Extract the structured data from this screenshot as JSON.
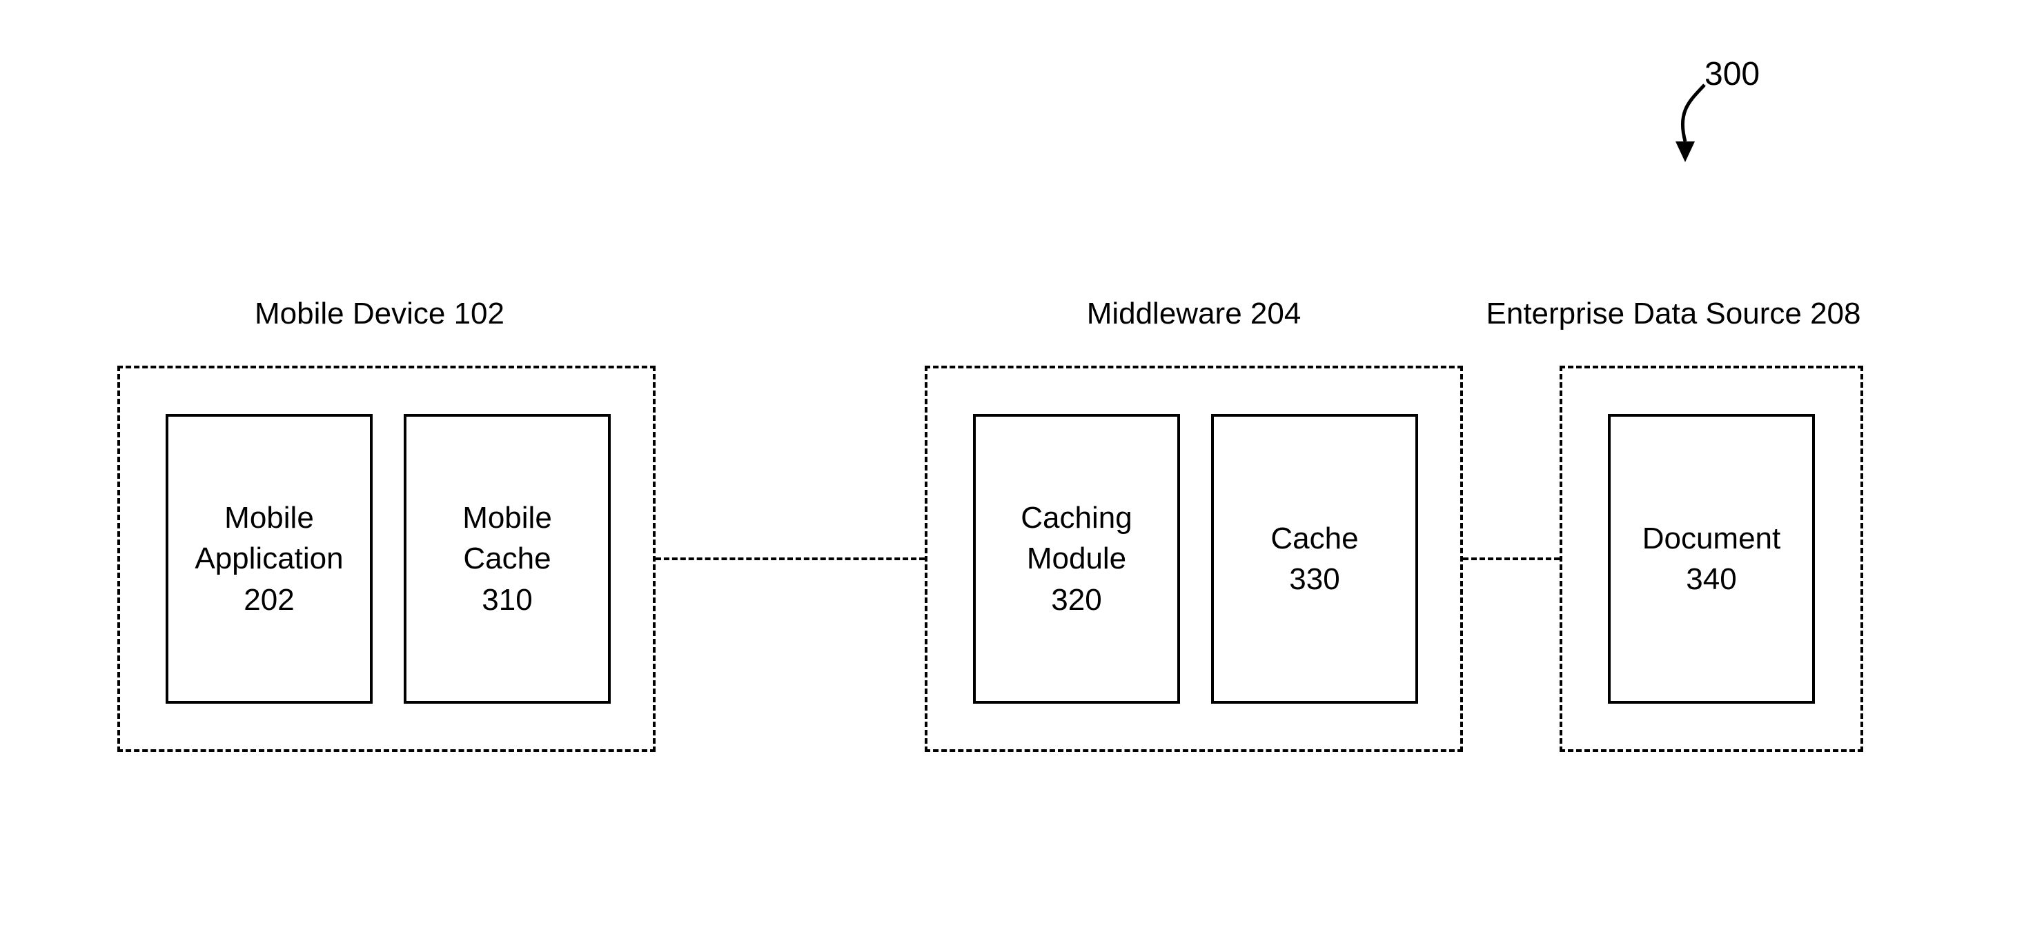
{
  "figure": {
    "number": "300"
  },
  "groups": {
    "mobile_device": {
      "label": "Mobile Device 102"
    },
    "middleware": {
      "label": "Middleware 204"
    },
    "enterprise": {
      "label": "Enterprise Data Source 208"
    }
  },
  "boxes": {
    "mobile_application": {
      "label": "Mobile\nApplication\n202"
    },
    "mobile_cache": {
      "label": "Mobile\nCache\n310"
    },
    "caching_module": {
      "label": "Caching\nModule\n320"
    },
    "cache": {
      "label": "Cache\n330"
    },
    "document": {
      "label": "Document\n340"
    }
  }
}
